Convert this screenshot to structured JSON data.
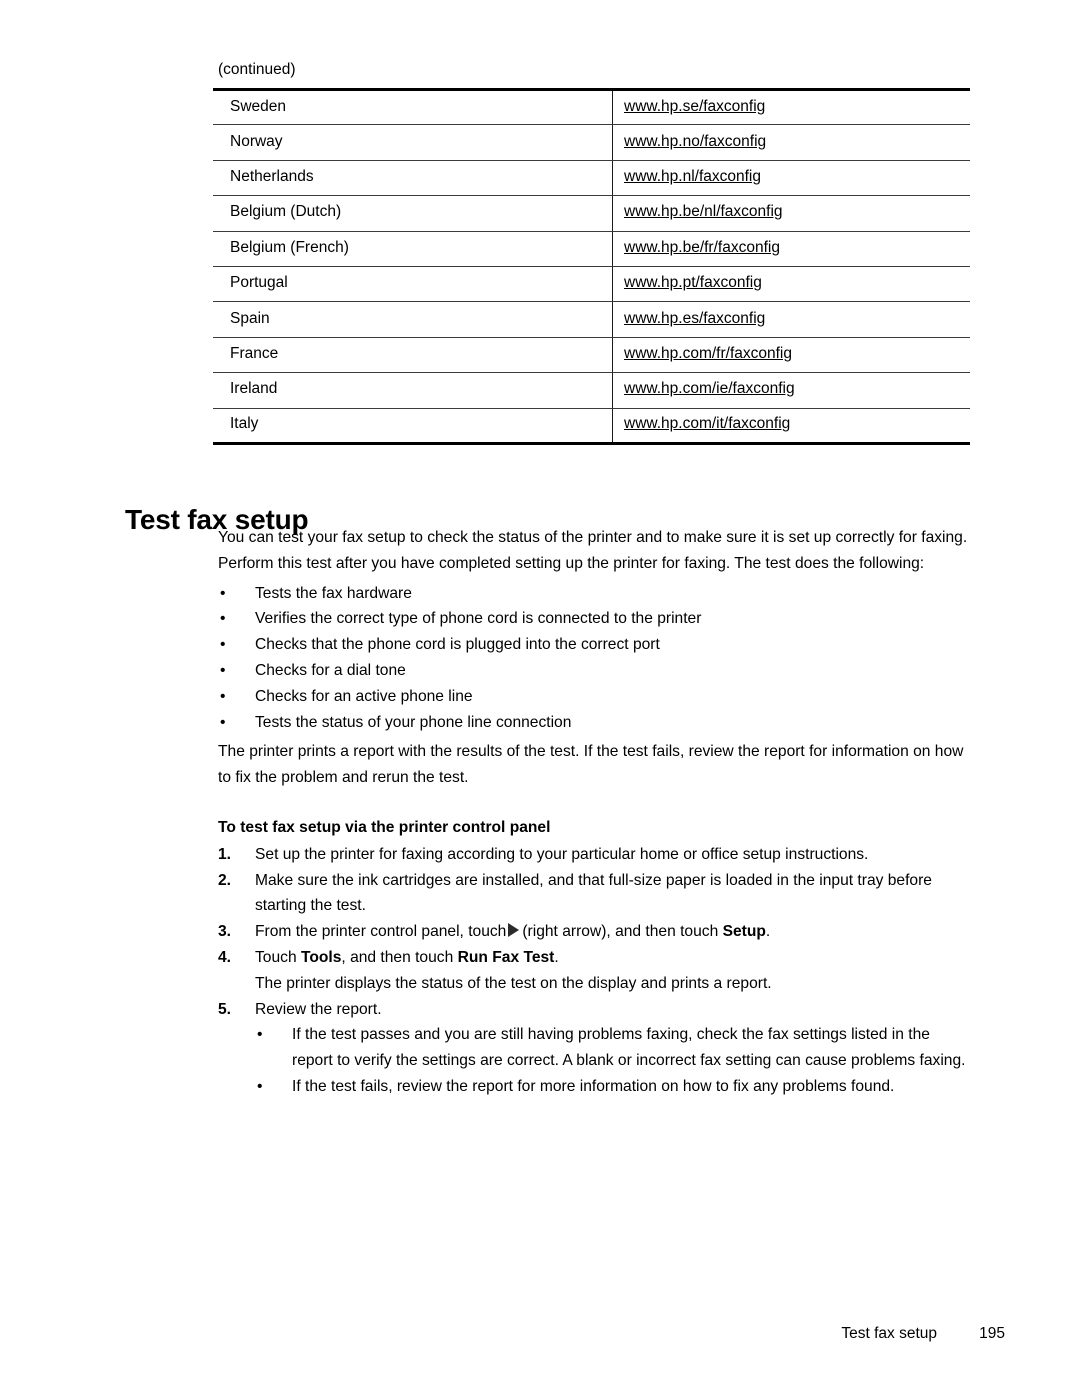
{
  "page": {
    "continued_label": "(continued)",
    "section_heading": "Test fax setup"
  },
  "fax_table": {
    "rows": [
      {
        "country": "Sweden",
        "url": "www.hp.se/faxconfig"
      },
      {
        "country": "Norway",
        "url": "www.hp.no/faxconfig"
      },
      {
        "country": "Netherlands",
        "url": "www.hp.nl/faxconfig"
      },
      {
        "country": "Belgium (Dutch)",
        "url": "www.hp.be/nl/faxconfig"
      },
      {
        "country": "Belgium (French)",
        "url": "www.hp.be/fr/faxconfig"
      },
      {
        "country": "Portugal",
        "url": "www.hp.pt/faxconfig"
      },
      {
        "country": "Spain",
        "url": "www.hp.es/faxconfig"
      },
      {
        "country": "France",
        "url": "www.hp.com/fr/faxconfig"
      },
      {
        "country": "Ireland",
        "url": "www.hp.com/ie/faxconfig"
      },
      {
        "country": "Italy",
        "url": "www.hp.com/it/faxconfig"
      }
    ]
  },
  "body": {
    "intro": "You can test your fax setup to check the status of the printer and to make sure it is set up correctly for faxing. Perform this test after you have completed setting up the printer for faxing. The test does the following:",
    "bullet_marker": "•",
    "checks": [
      "Tests the fax hardware",
      "Verifies the correct type of phone cord is connected to the printer",
      "Checks that the phone cord is plugged into the correct port",
      "Checks for a dial tone",
      "Checks for an active phone line",
      "Tests the status of your phone line connection"
    ],
    "report_note": "The printer prints a report with the results of the test. If the test fails, review the report for information on how to fix the problem and rerun the test.",
    "procedure_heading": "To test fax setup via the printer control panel",
    "steps": {
      "n1": "1.",
      "s1": "Set up the printer for faxing according to your particular home or office setup instructions.",
      "n2": "2.",
      "s2": "Make sure the ink cartridges are installed, and that full-size paper is loaded in the input tray before starting the test.",
      "n3": "3.",
      "s3_part1": "From the printer control panel, touch",
      "s3_part2": "(right arrow), and then touch",
      "s3_bold": "Setup",
      "s3_part3": ".",
      "n4": "4.",
      "s4_part1": "Touch",
      "s4_bold1": "Tools",
      "s4_part2": ", and then touch",
      "s4_bold2": "Run Fax Test",
      "s4_part3": ".",
      "s4_note": "The printer displays the status of the test on the display and prints a report.",
      "n5": "5.",
      "s5": "Review the report.",
      "s5_sub1": "If the test passes and you are still having problems faxing, check the fax settings listed in the report to verify the settings are correct. A blank or incorrect fax setting can cause problems faxing.",
      "s5_sub2": "If the test fails, review the report for more information on how to fix any problems found."
    }
  },
  "footer": {
    "title": "Test fax setup",
    "page_number": "195"
  }
}
